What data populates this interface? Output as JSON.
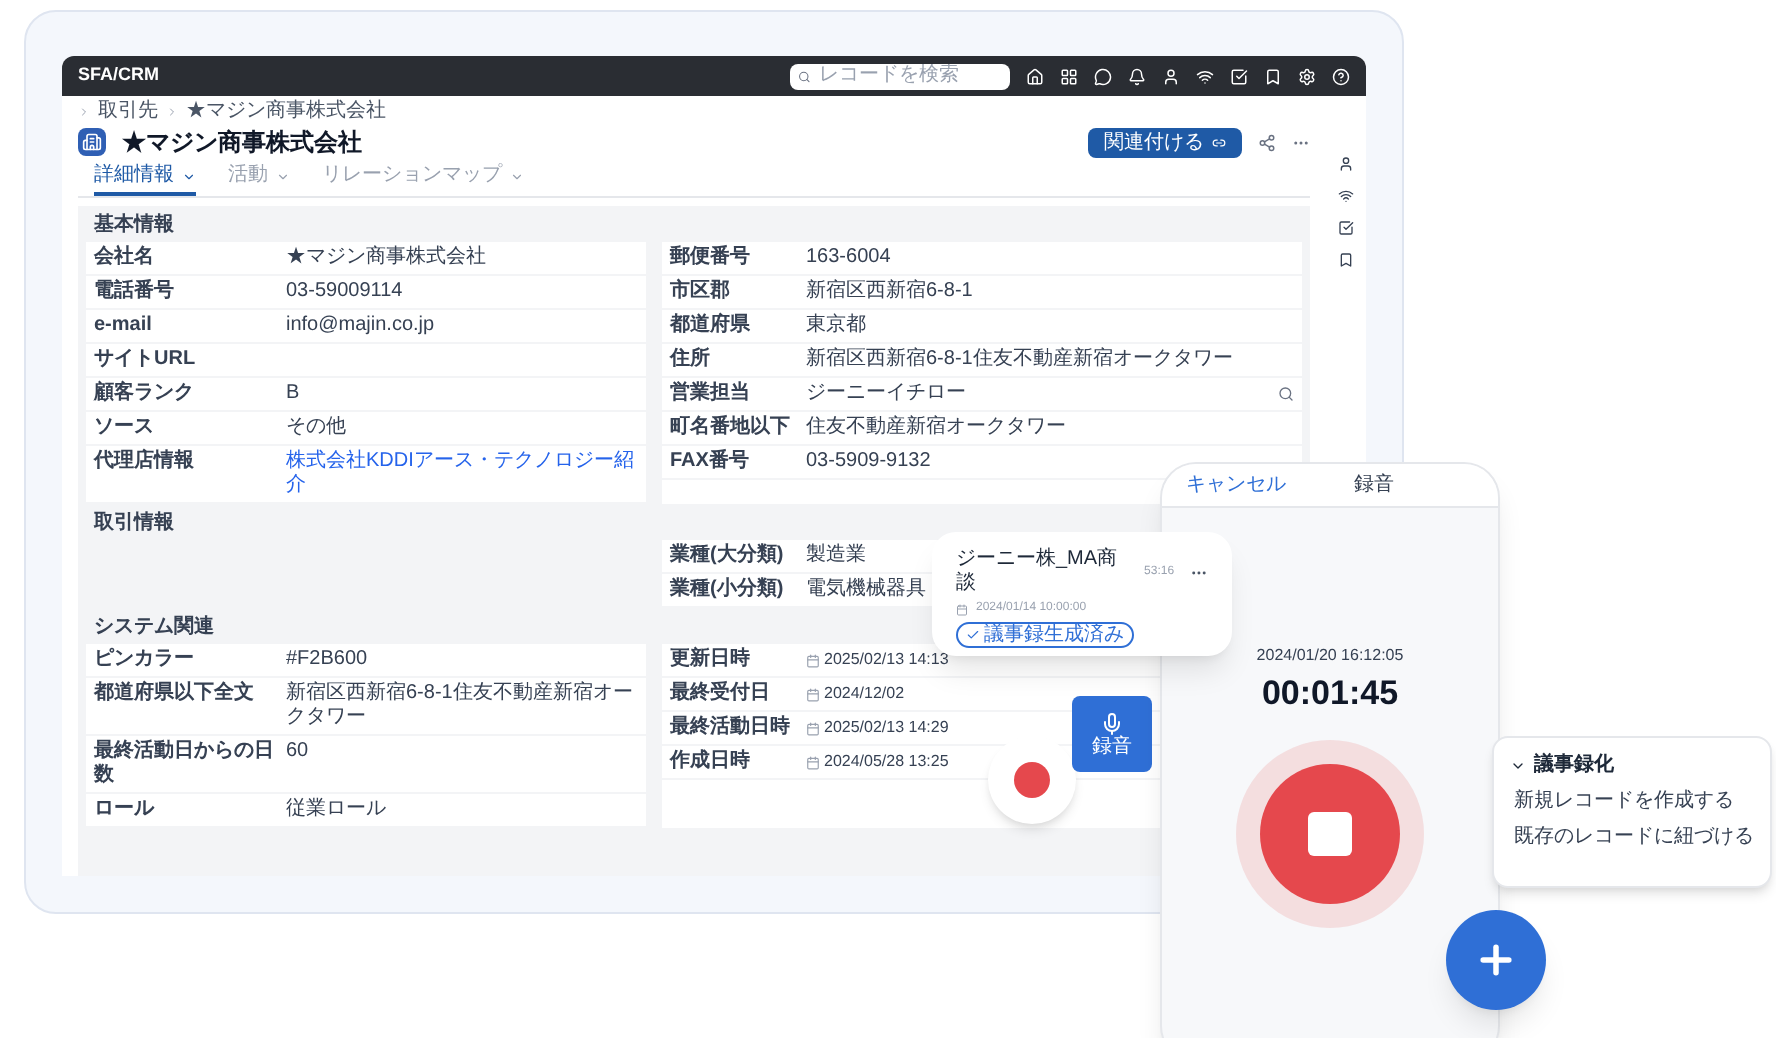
{
  "app": {
    "logo": "SFA/CRM"
  },
  "search": {
    "placeholder": "レコードを検索"
  },
  "breadcrumbs": [
    "取引先",
    "★マジン商事株式会社"
  ],
  "record": {
    "title": "★マジン商事株式会社",
    "action": "関連付ける"
  },
  "tabs": [
    {
      "label": "詳細情報",
      "selected": true
    },
    {
      "label": "活動",
      "selected": false
    },
    {
      "label": "リレーションマップ",
      "selected": false
    }
  ],
  "sections": [
    {
      "title": "基本情報",
      "left": [
        {
          "label": "会社名",
          "value": "★マジン商事株式会社",
          "kind": "text"
        },
        {
          "label": "電話番号",
          "value": "03-59009114",
          "kind": "text"
        },
        {
          "label": "e-mail",
          "value": "info@majin.co.jp",
          "kind": "text"
        },
        {
          "label": "サイトURL",
          "kind": "text"
        },
        {
          "label": "顧客ランク",
          "value": "B",
          "kind": "text"
        },
        {
          "label": "ソース",
          "value": "その他",
          "kind": "text"
        },
        {
          "label": "代理店情報",
          "value": "株式会社KDDIアース・テクノロジー紹介",
          "kind": "link"
        }
      ],
      "right": [
        {
          "label": "郵便番号",
          "value": "163-6004",
          "kind": "text"
        },
        {
          "label": "市区郡",
          "value": "新宿区西新宿6-8-1",
          "kind": "text"
        },
        {
          "label": "都道府県",
          "value": "東京都",
          "kind": "text"
        },
        {
          "label": "住所",
          "value": "新宿区西新宿6-8-1住友不動産新宿オークタワー",
          "kind": "text"
        },
        {
          "label": "営業担当",
          "value": "ジーニーイチロー",
          "kind": "lookup"
        },
        {
          "label": "町名番地以下",
          "value": "住友不動産新宿オークタワー",
          "kind": "text"
        },
        {
          "label": "FAX番号",
          "value": "03-5909-9132",
          "kind": "text"
        }
      ]
    },
    {
      "title": "取引情報",
      "right": [
        {
          "label": "業種(大分類)",
          "value": "製造業",
          "kind": "text"
        },
        {
          "label": "業種(小分類)",
          "value": "電気機械器具",
          "kind": "text"
        }
      ]
    },
    {
      "title": "システム関連",
      "left": [
        {
          "label": "ピンカラー",
          "value": "#F2B600",
          "kind": "text"
        },
        {
          "label": "都道府県以下全文",
          "value": "新宿区西新宿6-8-1住友不動産新宿オークタワー",
          "kind": "text"
        },
        {
          "label": "最終活動日からの日数",
          "value": "60",
          "kind": "text"
        },
        {
          "label": "ロール",
          "value": "従業ロール",
          "kind": "text"
        }
      ],
      "right": [
        {
          "label": "更新日時",
          "value": "2025/02/13 14:13",
          "kind": "date"
        },
        {
          "label": "最終受付日",
          "value": "2024/12/02",
          "kind": "date"
        },
        {
          "label": "最終活動日時",
          "value": "2025/02/13 14:29",
          "kind": "date"
        },
        {
          "label": "作成日時",
          "value": "2024/05/28 13:25",
          "kind": "date"
        }
      ]
    }
  ],
  "call_card": {
    "title": "ジーニー株_MA商談",
    "duration": "53:16",
    "datetime": "2024/01/14 10:00:00",
    "badge": "議事録生成済み"
  },
  "record_button": {
    "label": "録音"
  },
  "phone": {
    "cancel": "キャンセル",
    "title": "録音",
    "timestamp": "2024/01/20 16:12:05",
    "elapsed": "00:01:45"
  },
  "menu": {
    "title": "議事録化",
    "expanded": true,
    "items": [
      "新規レコードを作成する",
      "既存のレコードに紐づける"
    ]
  }
}
